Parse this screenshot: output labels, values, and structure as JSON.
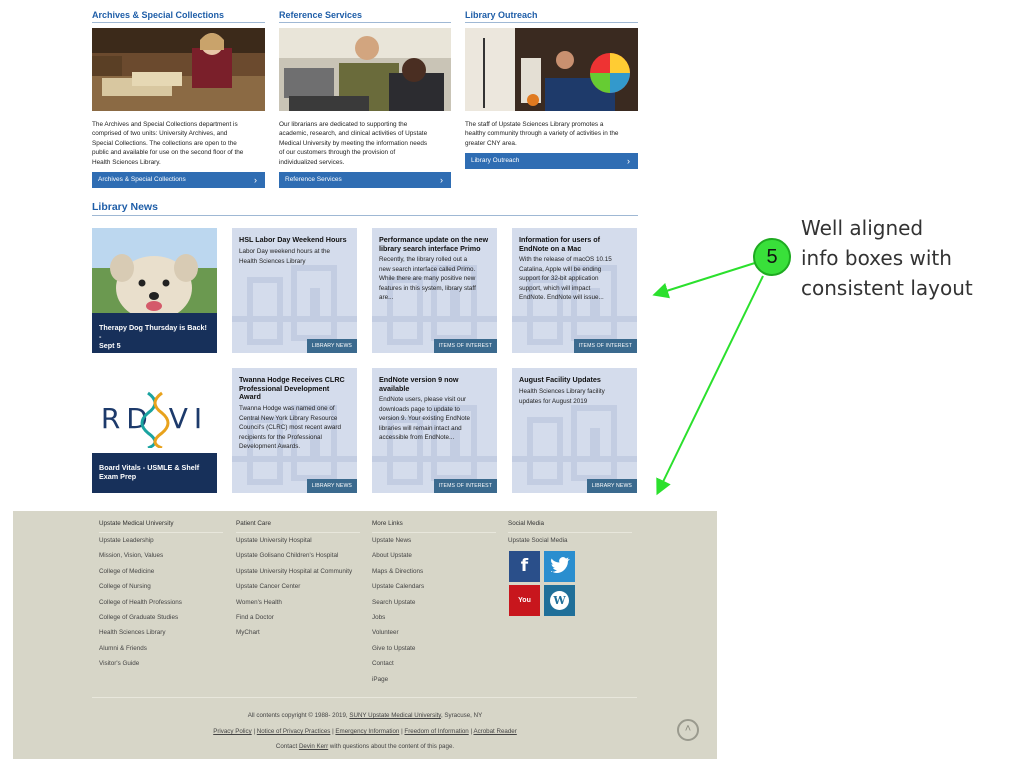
{
  "sections": [
    {
      "title": "Archives & Special Collections",
      "desc_lines": [
        "The Archives and Special Collections department is",
        "comprised of two units: University Archives, and",
        "Special Collections. The collections are open to the",
        "public and available for use on the second floor of the",
        "Health Sciences Library."
      ],
      "cta": "Archives & Special Collections"
    },
    {
      "title": "Reference Services",
      "desc_lines": [
        "Our librarians are dedicated to supporting the",
        "academic, research, and clinical activities of Upstate",
        "Medical University by meeting the information needs",
        "of our customers through the provision of",
        "individualized services."
      ],
      "cta": "Reference Services"
    },
    {
      "title": "Library Outreach",
      "desc_lines": [
        "The staff of Upstate Sciences Library promotes a",
        "healthy community through a variety of activities in the",
        "greater CNY area."
      ],
      "cta": "Library Outreach"
    }
  ],
  "news": {
    "title": "Library News",
    "cards": [
      {
        "kind": "image",
        "caption_lines": [
          "Therapy Dog Thursday is Back! -",
          "Sept 5"
        ]
      },
      {
        "kind": "text",
        "title_lines": [
          "HSL Labor Day Weekend Hours"
        ],
        "body_lines": [
          "Labor Day weekend hours at the",
          "Health Sciences Library"
        ],
        "tag": "LIBRARY NEWS"
      },
      {
        "kind": "text",
        "title_lines": [
          "Performance update on the new",
          "library search interface Primo"
        ],
        "body_lines": [
          "Recently, the library rolled out a",
          "new search interface called Primo.",
          "While there are many positive new",
          "features in this system, library staff",
          "are..."
        ],
        "tag": "ITEMS OF INTEREST"
      },
      {
        "kind": "text",
        "title_lines": [
          "Information for users of",
          "EndNote on a Mac"
        ],
        "body_lines": [
          "With the release of macOS 10.15",
          "Catalina, Apple will be ending",
          "support for 32-bit application",
          "support, which will impact",
          "EndNote. EndNote will issue..."
        ],
        "tag": "ITEMS OF INTEREST"
      },
      {
        "kind": "image",
        "caption_lines": [
          "Board Vitals - USMLE & Shelf",
          "Exam Prep"
        ],
        "logo_text": "RD   VI"
      },
      {
        "kind": "text",
        "title_lines": [
          "Twanna Hodge Receives CLRC",
          "Professional Development",
          "Award"
        ],
        "body_lines": [
          "Twanna Hodge was named one of",
          "Central New York Library Resource",
          "Council's (CLRC) most recent award",
          "recipients for the Professional",
          "Development Awards."
        ],
        "tag": "LIBRARY NEWS"
      },
      {
        "kind": "text",
        "title_lines": [
          "EndNote version 9 now",
          "available"
        ],
        "body_lines": [
          "EndNote users, please visit our",
          "downloads page to update to",
          "version 9. Your existing EndNote",
          "libraries will remain intact and",
          "accessible from EndNote..."
        ],
        "tag": "ITEMS OF INTEREST"
      },
      {
        "kind": "text",
        "title_lines": [
          "August Facility Updates"
        ],
        "body_lines": [
          "Health Sciences Library facility",
          "updates for August 2019"
        ],
        "tag": "LIBRARY NEWS"
      }
    ]
  },
  "annotation": {
    "number": "5",
    "lines": [
      "Well aligned",
      "info boxes with",
      "consistent layout"
    ],
    "color": "#39e03a"
  },
  "footer": {
    "columns": [
      {
        "items": [
          "Upstate Medical University",
          "Upstate Leadership",
          "Mission, Vision, Values",
          "College of Medicine",
          "College of Nursing",
          "College of Health Professions",
          "College of Graduate Studies",
          "Health Sciences Library",
          "Alumni & Friends",
          "Visitor's Guide"
        ]
      },
      {
        "items": [
          "Patient Care",
          "Upstate University Hospital",
          "Upstate Golisano Children's Hospital",
          "Upstate University Hospital at Community",
          "Upstate Cancer Center",
          "Women's Health",
          "Find a Doctor",
          "MyChart"
        ]
      },
      {
        "items": [
          "More Links",
          "Upstate News",
          "About Upstate",
          "Maps & Directions",
          "Upstate Calendars",
          "Search Upstate",
          "Jobs",
          "Volunteer",
          "Give to Upstate",
          "Contact",
          "iPage"
        ]
      },
      {
        "items": [
          "Social Media",
          "Upstate Social Media"
        ]
      }
    ],
    "social": [
      {
        "name": "facebook",
        "glyph": "f",
        "color": "#2a4f8a"
      },
      {
        "name": "twitter",
        "glyph": "🐦",
        "color": "#2a8ecf"
      },
      {
        "name": "youtube",
        "glyph": "You",
        "color": "#c8161d"
      },
      {
        "name": "wordpress",
        "glyph": "W",
        "color": "#1f6f99"
      }
    ],
    "copyright": {
      "prefix": "All contents copyright © 1988- 2019,",
      "link": "SUNY Upstate Medical University",
      "suffix": ", Syracuse, NY"
    },
    "legal_links": [
      "Privacy Policy",
      "Notice of Privacy Practices",
      "Emergency Information",
      "Freedom of Information",
      "Acrobat Reader"
    ],
    "contact": {
      "prefix": "Contact",
      "link": "Devin Kerr",
      "suffix": "with questions about the content of this page."
    }
  }
}
